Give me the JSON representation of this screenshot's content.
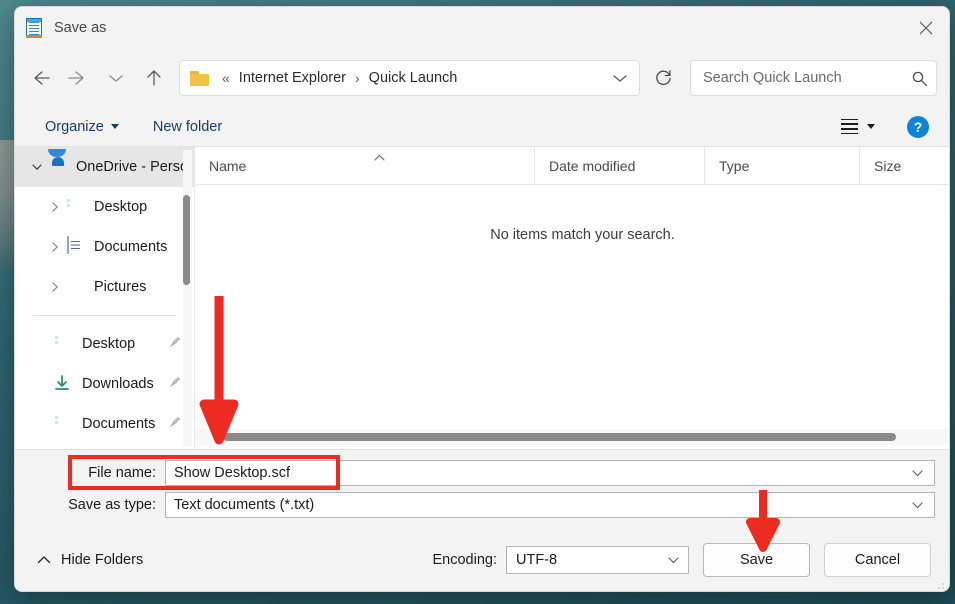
{
  "window": {
    "title": "Save as",
    "app_icon": "notepad-icon",
    "close_label": "✕"
  },
  "nav": {
    "back": "back-arrow",
    "forward": "forward-arrow",
    "recent": "recent-locations-chevron",
    "up": "up-arrow",
    "refresh": "refresh-icon",
    "breadcrumb": {
      "overflow": "«",
      "separator": "›",
      "items": [
        "Internet Explorer",
        "Quick Launch"
      ]
    }
  },
  "search": {
    "placeholder": "Search Quick Launch",
    "value": "",
    "icon": "search-icon"
  },
  "commandbar": {
    "organize": "Organize",
    "new_folder": "New folder",
    "view_icon": "list-view-icon",
    "help": "?"
  },
  "sidebar": {
    "items": [
      {
        "label": "OneDrive - Perso",
        "icon": "onedrive-icon",
        "expandable": true,
        "expanded": true,
        "selected": true,
        "indent": 0
      },
      {
        "label": "Desktop",
        "icon": "desktop-icon",
        "expandable": true,
        "expanded": false,
        "selected": false,
        "indent": 1
      },
      {
        "label": "Documents",
        "icon": "documents-icon",
        "expandable": true,
        "expanded": false,
        "selected": false,
        "indent": 1
      },
      {
        "label": "Pictures",
        "icon": "pictures-icon",
        "expandable": true,
        "expanded": false,
        "selected": false,
        "indent": 1
      }
    ],
    "quick_access": [
      {
        "label": "Desktop",
        "icon": "desktop-icon",
        "pinned": true
      },
      {
        "label": "Downloads",
        "icon": "downloads-icon",
        "pinned": true
      },
      {
        "label": "Documents",
        "icon": "documents-icon",
        "pinned": true
      }
    ]
  },
  "filelist": {
    "columns": [
      "Name",
      "Date modified",
      "Type",
      "Size"
    ],
    "sort_column": "Name",
    "sort_direction": "ascending",
    "rows": [],
    "empty_message": "No items match your search."
  },
  "form": {
    "filename_label": "File name:",
    "filename_value": "Show Desktop.scf",
    "savetype_label": "Save as type:",
    "savetype_value": "Text documents (*.txt)"
  },
  "footer": {
    "hide_folders": "Hide Folders",
    "encoding_label": "Encoding:",
    "encoding_value": "UTF-8",
    "save_button": "Save",
    "cancel_button": "Cancel"
  },
  "annotations": {
    "highlight_color": "#ee2b20",
    "arrow_filename": "points-to-file-name-field",
    "arrow_save": "points-to-save-button",
    "box_filename": "highlights-file-name-row"
  }
}
